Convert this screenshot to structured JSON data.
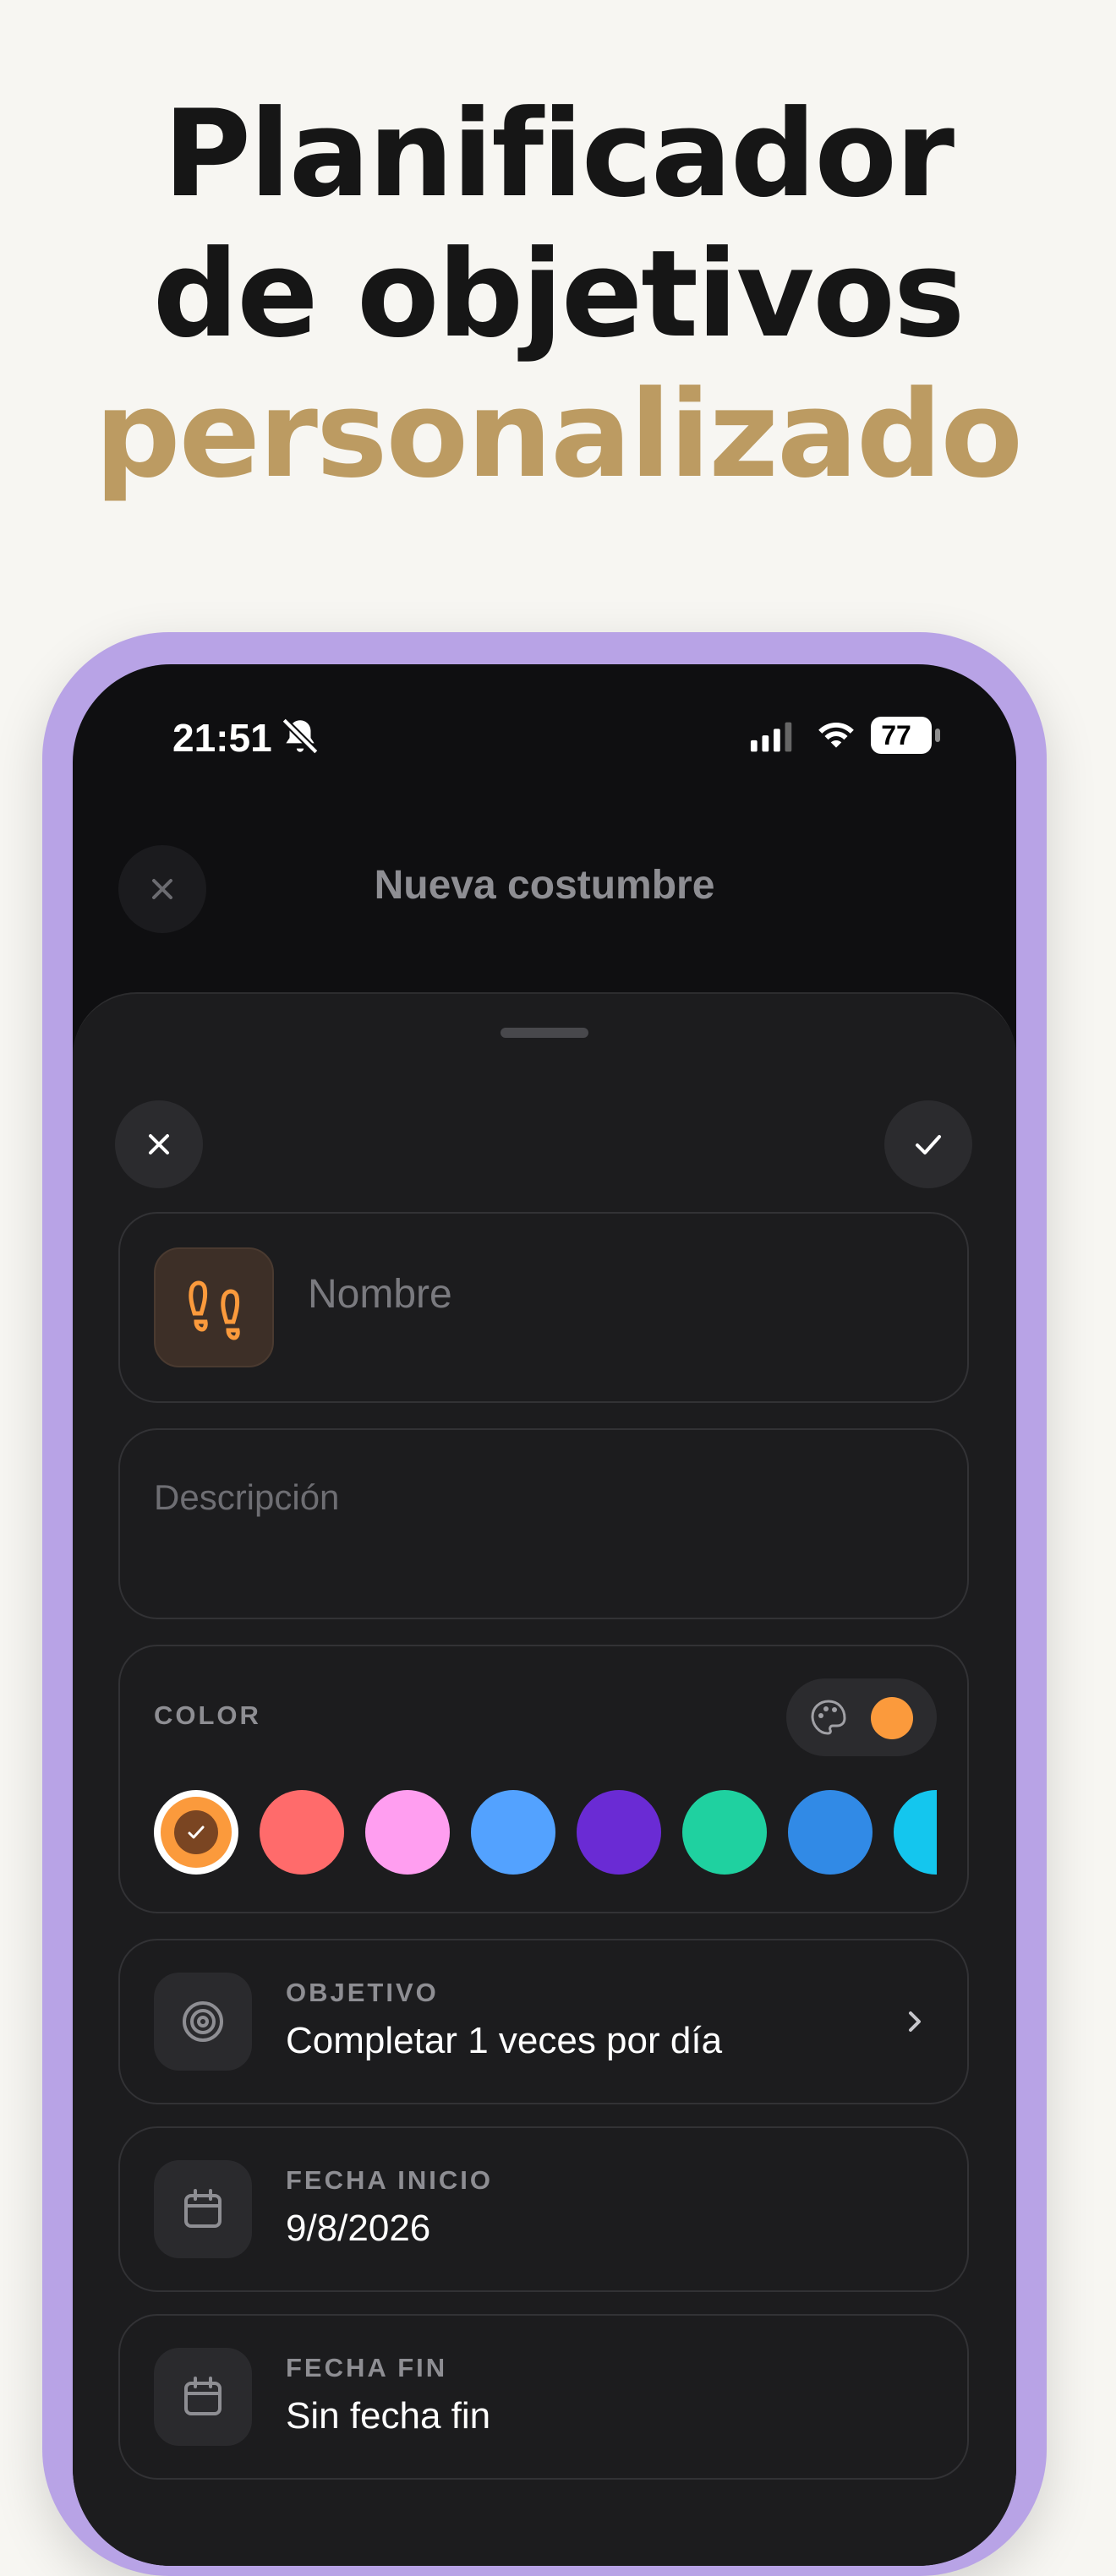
{
  "headline": {
    "line1": "Planificador",
    "line2": "de objetivos",
    "line3": "personalizado",
    "accent_color": "#bc9b62"
  },
  "phone": {
    "frame_color": "#b8a3e6",
    "status_bar": {
      "time": "21:51",
      "battery": "77"
    },
    "nav": {
      "title": "Nueva costumbre"
    },
    "sheet": {
      "name_placeholder": "Nombre",
      "habit_icon": "footprints-icon",
      "description_placeholder": "Descripción",
      "color_section": {
        "label": "COLOR",
        "custom_color": "#fb9a3c",
        "swatches": [
          "#fb9a3c",
          "#ff6b6b",
          "#ff9ef0",
          "#53a2ff",
          "#6a2bd4",
          "#1fd1a0",
          "#318ae6",
          "#14c6ee"
        ],
        "selected_index": 0
      },
      "goal": {
        "label": "OBJETIVO",
        "value": "Completar 1 veces por día"
      },
      "start_date": {
        "label": "FECHA INICIO",
        "value": "9/8/2026"
      },
      "end_date": {
        "label": "FECHA FIN",
        "value": "Sin fecha fin"
      }
    }
  }
}
